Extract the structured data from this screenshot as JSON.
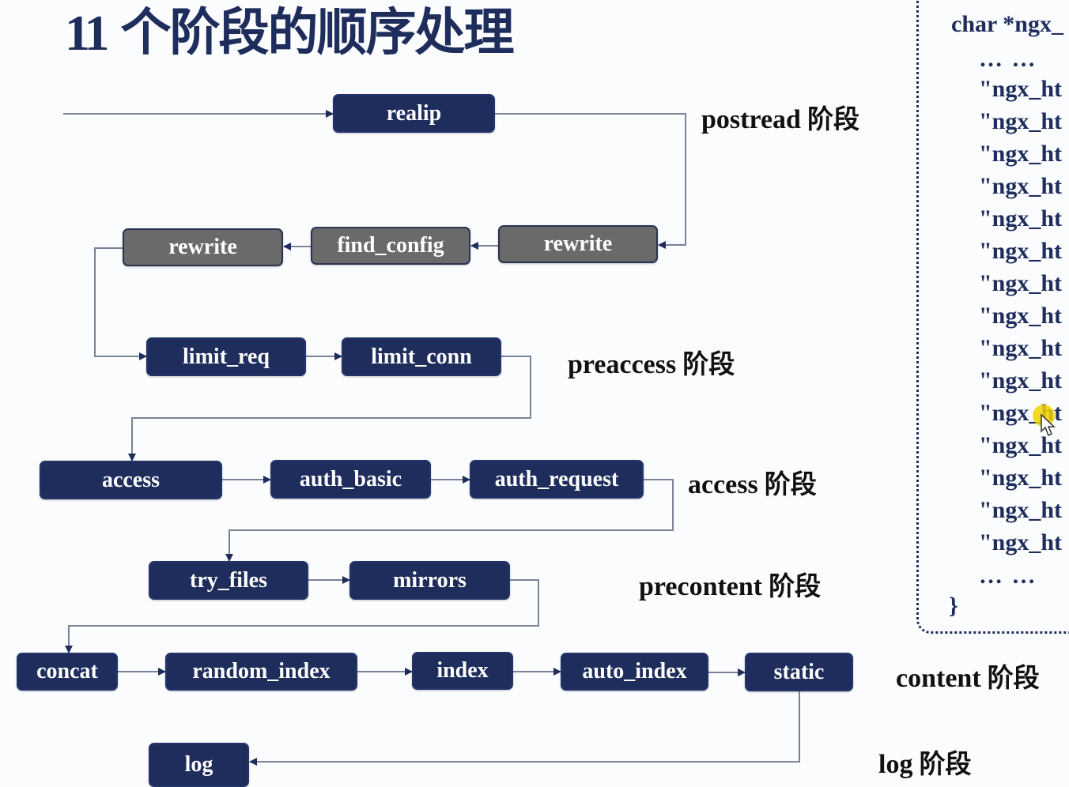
{
  "title": {
    "number": "11",
    "text": "个阶段的顺序处理"
  },
  "nodes": {
    "realip": "realip",
    "rewrite_server": "rewrite",
    "find_config": "find_config",
    "rewrite_location": "rewrite",
    "limit_req": "limit_req",
    "limit_conn": "limit_conn",
    "access": "access",
    "auth_basic": "auth_basic",
    "auth_request": "auth_request",
    "try_files": "try_files",
    "mirrors": "mirrors",
    "concat": "concat",
    "random_index": "random_index",
    "index": "index",
    "auto_index": "auto_index",
    "static": "static",
    "log": "log"
  },
  "phases": {
    "postread": {
      "name": "postread",
      "suffix": "阶段"
    },
    "preaccess": {
      "name": "preaccess",
      "suffix": "阶段"
    },
    "access": {
      "name": "access",
      "suffix": "阶段"
    },
    "precontent": {
      "name": "precontent",
      "suffix": "阶段"
    },
    "content": {
      "name": "content",
      "suffix": "阶段"
    },
    "log": {
      "name": "log",
      "suffix": "阶段"
    }
  },
  "code": {
    "header": "char *ngx_",
    "ellipsis_top": "… …",
    "lines": [
      "\"ngx_ht",
      "\"ngx_ht",
      "\"ngx_ht",
      "\"ngx_ht",
      "\"ngx_ht",
      "\"ngx_ht",
      "\"ngx_ht",
      "\"ngx_ht",
      "\"ngx_ht",
      "\"ngx_ht",
      "\"ngx_ht",
      "\"ngx_ht",
      "\"ngx_ht",
      "\"ngx_ht",
      "\"ngx_ht"
    ],
    "ellipsis_bottom": "… …",
    "closing": "}"
  },
  "colors": {
    "node": "#1e2d5c",
    "node_gray": "#6a6a6a",
    "connector": "#7a8299",
    "title": "#1e2d5c"
  }
}
